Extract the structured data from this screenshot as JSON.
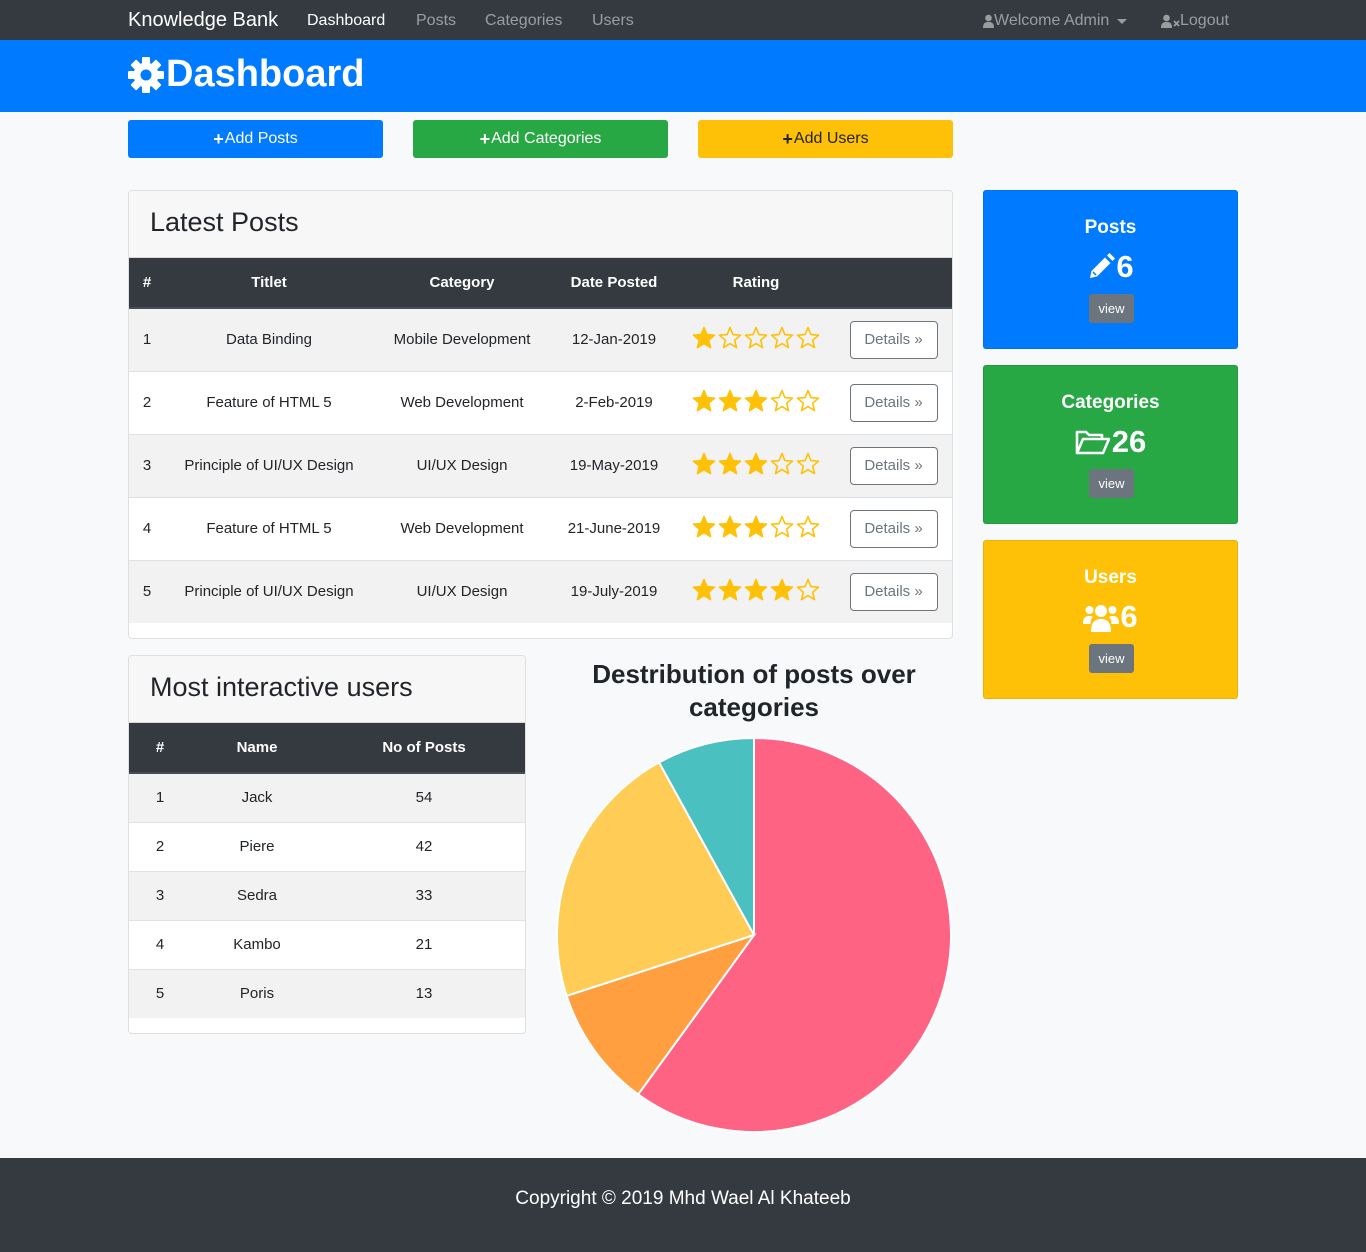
{
  "nav": {
    "brand": "Knowledge Bank",
    "links": [
      {
        "label": "Dashboard",
        "active": true
      },
      {
        "label": "Posts",
        "active": false
      },
      {
        "label": "Categories",
        "active": false
      },
      {
        "label": "Users",
        "active": false
      }
    ],
    "welcome": "Welcome Admin",
    "logout": "Logout"
  },
  "header": {
    "title": "Dashboard",
    "icon": "gear-icon"
  },
  "actions": {
    "add_posts": "Add Posts",
    "add_categories": "Add Categories",
    "add_users": "Add Users"
  },
  "latest_posts": {
    "title": "Latest Posts",
    "columns": [
      "#",
      "Titlet",
      "Category",
      "Date Posted",
      "Rating"
    ],
    "details_label": "Details »",
    "rows": [
      {
        "num": "1",
        "title": "Data Binding",
        "category": "Mobile Development",
        "date": "12-Jan-2019",
        "rating": 1
      },
      {
        "num": "2",
        "title": "Feature of HTML 5",
        "category": "Web Development",
        "date": "2-Feb-2019",
        "rating": 3
      },
      {
        "num": "3",
        "title": "Principle of UI/UX Design",
        "category": "UI/UX Design",
        "date": "19-May-2019",
        "rating": 3
      },
      {
        "num": "4",
        "title": "Feature of HTML 5",
        "category": "Web Development",
        "date": "21-June-2019",
        "rating": 3
      },
      {
        "num": "5",
        "title": "Principle of UI/UX Design",
        "category": "UI/UX Design",
        "date": "19-July-2019",
        "rating": 4
      }
    ],
    "max_rating": 5
  },
  "top_users": {
    "title": "Most interactive users",
    "columns": [
      "#",
      "Name",
      "No of Posts"
    ],
    "rows": [
      {
        "num": "1",
        "name": "Jack",
        "posts": "54"
      },
      {
        "num": "2",
        "name": "Piere",
        "posts": "42"
      },
      {
        "num": "3",
        "name": "Sedra",
        "posts": "33"
      },
      {
        "num": "4",
        "name": "Kambo",
        "posts": "21"
      },
      {
        "num": "5",
        "name": "Poris",
        "posts": "13"
      }
    ]
  },
  "stats": {
    "posts": {
      "label": "Posts",
      "value": "6",
      "button": "view",
      "icon": "pencil-icon"
    },
    "categories": {
      "label": "Categories",
      "value": "26",
      "button": "view",
      "icon": "folder-open-icon"
    },
    "users": {
      "label": "Users",
      "value": "6",
      "button": "view",
      "icon": "users-icon"
    }
  },
  "colors": {
    "primary": "#007bff",
    "success": "#28a745",
    "warning": "#ffc107",
    "dark": "#343a40",
    "star": "#ffc107"
  },
  "chart_data": {
    "type": "pie",
    "title": "Destribution of posts over categories",
    "slices": [
      {
        "value": 60,
        "color": "#ff6384"
      },
      {
        "value": 10,
        "color": "#ff9f40"
      },
      {
        "value": 22,
        "color": "#ffcd56"
      },
      {
        "value": 8,
        "color": "#4bc0c0"
      }
    ]
  },
  "footer": {
    "text": "Copyright © 2019 Mhd Wael Al Khateeb"
  }
}
